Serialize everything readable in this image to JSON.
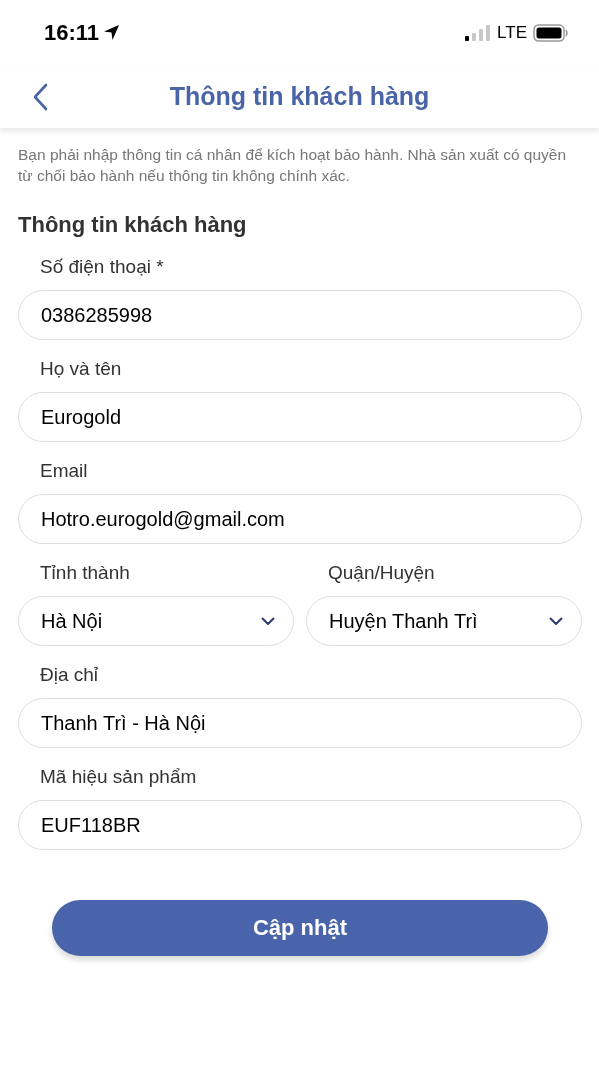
{
  "status_bar": {
    "time": "16:11",
    "network": "LTE"
  },
  "header": {
    "title": "Thông tin khách hàng"
  },
  "notice": "Bạn phải nhập thông tin cá nhân để kích hoạt bảo hành. Nhà sản xuất có quyền từ chối bảo hành nếu thông tin không chính xác.",
  "section_title": "Thông tin khách hàng",
  "fields": [
    {
      "kind": "input",
      "label": "Số điện thoại *",
      "value": "0386285998"
    },
    {
      "kind": "input",
      "label": "Họ và tên",
      "value": "Eurogold"
    },
    {
      "kind": "input",
      "label": "Email",
      "value": "Hotro.eurogold@gmail.com"
    },
    {
      "kind": "pair",
      "items": [
        {
          "label": "Tỉnh thành",
          "value": "Hà Nội"
        },
        {
          "label": "Quận/Huyện",
          "value": "Huyện Thanh Trì"
        }
      ]
    },
    {
      "kind": "input",
      "label": "Địa chỉ",
      "value": "Thanh Trì - Hà Nội"
    },
    {
      "kind": "input",
      "label": "Mã hiệu sản phẩm",
      "value": "EUF118BR"
    }
  ],
  "submit_button": "Cập nhật"
}
